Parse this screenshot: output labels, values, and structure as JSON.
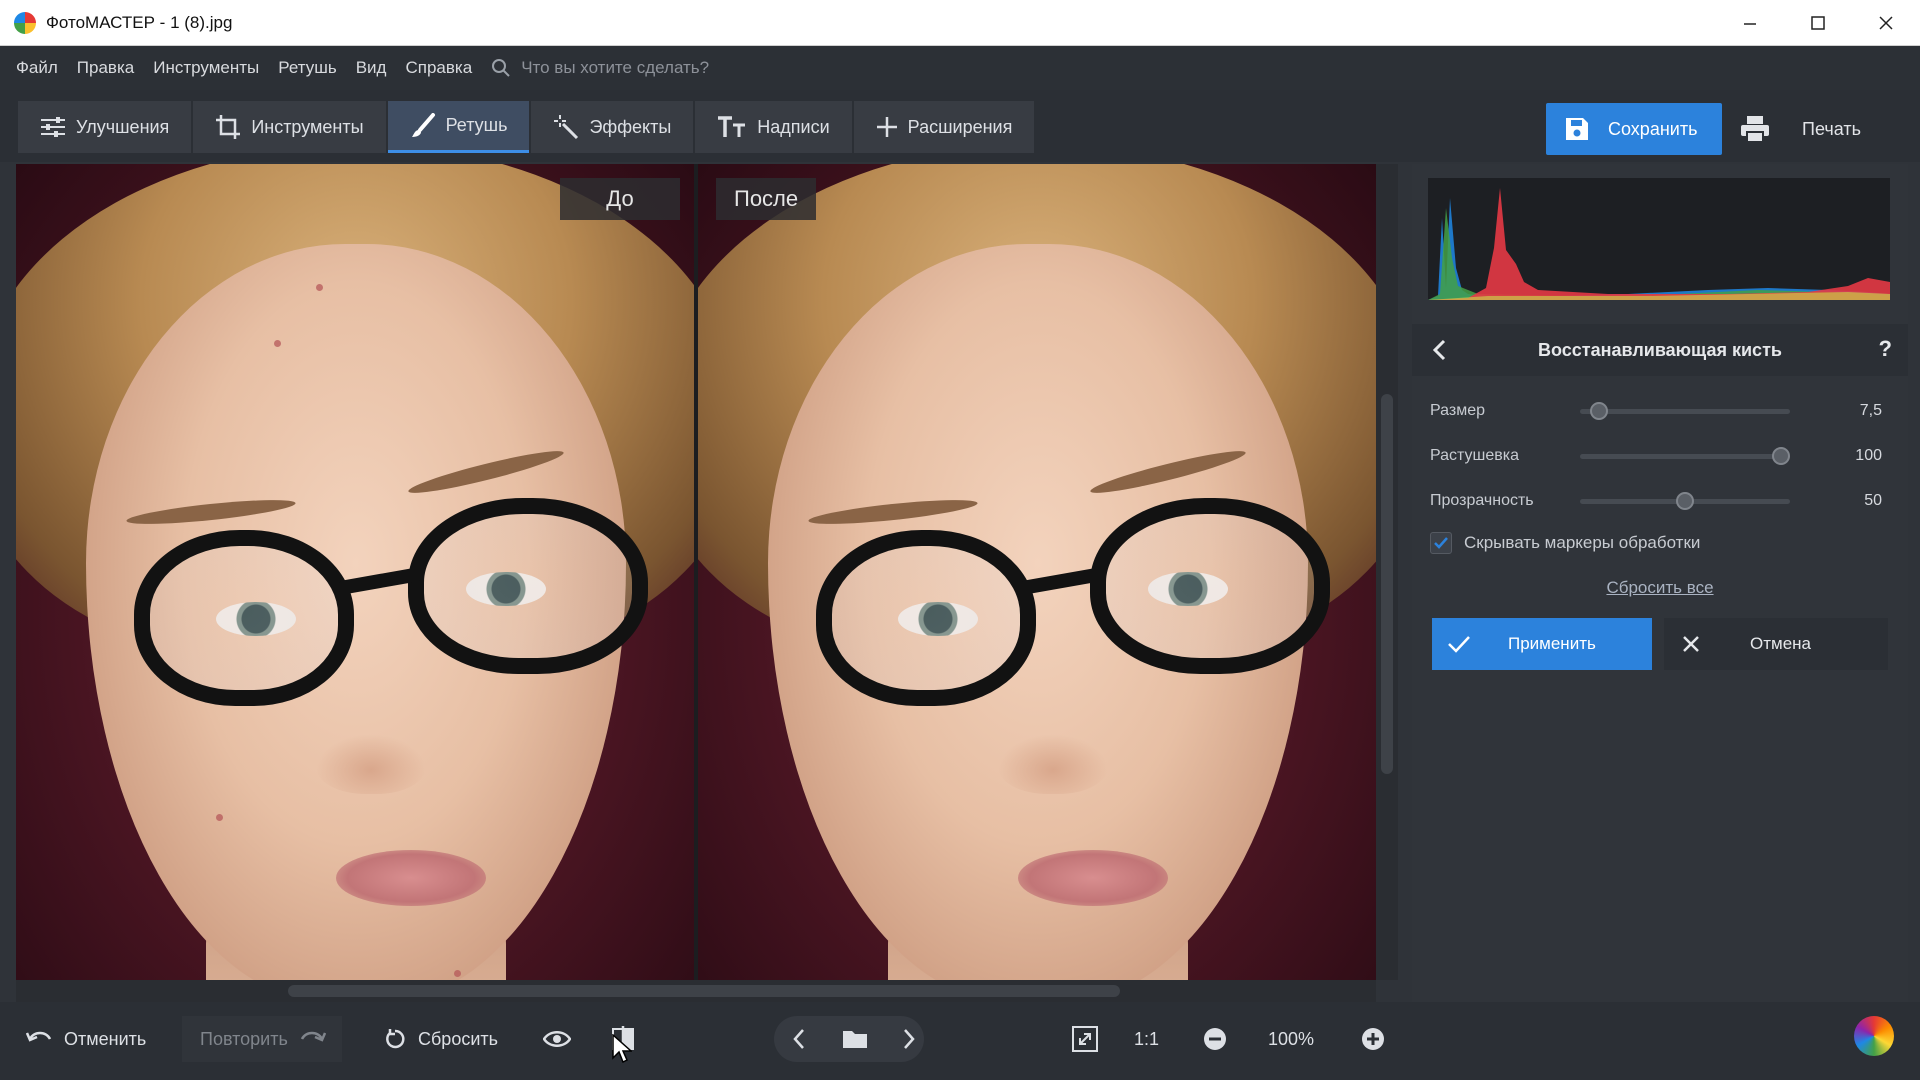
{
  "window": {
    "title": "ФотоМАСТЕР - 1 (8).jpg",
    "controls": [
      "minimize-icon",
      "maximize-icon",
      "close-icon"
    ]
  },
  "menu": {
    "items": [
      "Файл",
      "Правка",
      "Инструменты",
      "Ретушь",
      "Вид",
      "Справка"
    ],
    "search_placeholder": "Что вы хотите сделать?"
  },
  "tabs": [
    {
      "label": "Улучшения",
      "icon": "sliders-icon"
    },
    {
      "label": "Инструменты",
      "icon": "crop-icon"
    },
    {
      "label": "Ретушь",
      "icon": "brush-icon",
      "active": true
    },
    {
      "label": "Эффекты",
      "icon": "magic-wand-icon"
    },
    {
      "label": "Надписи",
      "icon": "text-icon"
    },
    {
      "label": "Расширения",
      "icon": "plus-icon"
    }
  ],
  "actions": {
    "save_label": "Сохранить",
    "print_label": "Печать"
  },
  "compare": {
    "before_label": "До",
    "after_label": "После"
  },
  "panel": {
    "tool_title": "Восстанавливающая кисть",
    "help": "?",
    "sliders": [
      {
        "label": "Размер",
        "value": "7,5",
        "fraction": 0.05
      },
      {
        "label": "Растушевка",
        "value": "100",
        "fraction": 1.0
      },
      {
        "label": "Прозрачность",
        "value": "50",
        "fraction": 0.5
      }
    ],
    "hide_markers_label": "Скрывать маркеры обработки",
    "hide_markers_checked": true,
    "reset_all_label": "Сбросить все",
    "apply_label": "Применить",
    "cancel_label": "Отмена"
  },
  "bottom": {
    "undo_label": "Отменить",
    "redo_label": "Повторить",
    "reset_label": "Сбросить",
    "ratio_label": "1:1",
    "zoom_value": "100%"
  },
  "colors": {
    "accent": "#2c82dc",
    "panel_bg": "#30343a",
    "toolbar_bg": "#2b2f35"
  }
}
